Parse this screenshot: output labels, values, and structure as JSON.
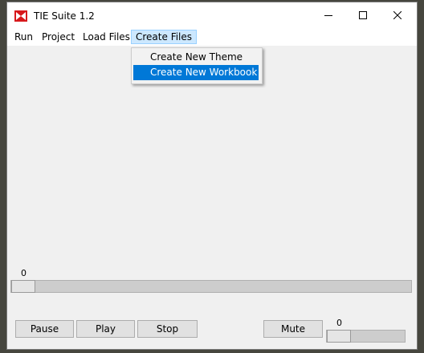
{
  "window": {
    "title": "TIE Suite 1.2",
    "accent": "#d7191c"
  },
  "titlebar_buttons": [
    "minimize-icon",
    "maximize-icon",
    "close-icon"
  ],
  "menu": {
    "items": [
      "Run",
      "Project",
      "Load Files",
      "Create Files"
    ],
    "active": "Create Files",
    "dropdown": {
      "items": [
        "Create New Theme",
        "Create New Workbook"
      ],
      "highlighted": "Create New Workbook"
    }
  },
  "position_slider": {
    "value_label": "0",
    "value": 0
  },
  "controls": {
    "pause_label": "Pause",
    "play_label": "Play",
    "stop_label": "Stop",
    "mute_label": "Mute"
  },
  "volume_slider": {
    "value_label": "0",
    "value": 0
  },
  "colors": {
    "highlight": "#0078d7",
    "menu_active_bg": "#cce8ff"
  }
}
